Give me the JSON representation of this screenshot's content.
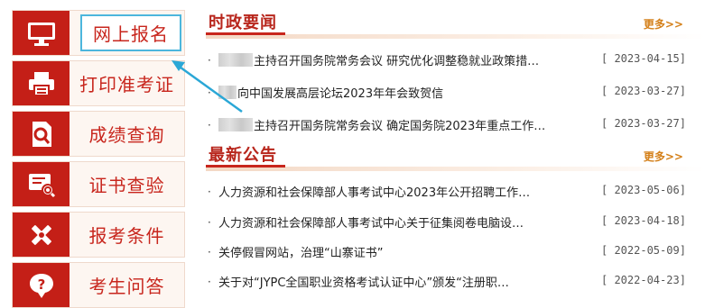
{
  "menu": {
    "items": [
      {
        "label": "网上报名",
        "icon": "monitor-icon",
        "active": true
      },
      {
        "label": "打印准考证",
        "icon": "printer-icon",
        "active": false
      },
      {
        "label": "成绩查询",
        "icon": "search-document-icon",
        "active": false
      },
      {
        "label": "证书查验",
        "icon": "certificate-search-icon",
        "active": false
      },
      {
        "label": "报考条件",
        "icon": "tools-icon",
        "active": false
      },
      {
        "label": "考生问答",
        "icon": "question-icon",
        "active": false
      }
    ]
  },
  "policy": {
    "title": "时政要闻",
    "more": "更多>>",
    "items": [
      {
        "prefix_blur": "wide",
        "title": "主持召开国务院常务会议 研究优化调整稳就业政策措…",
        "date": "[ 2023-04-15]"
      },
      {
        "prefix_blur": "narrow",
        "title": "向中国发展高层论坛2023年年会致贺信",
        "date": "[ 2023-03-27]"
      },
      {
        "prefix_blur": "wide",
        "title": "主持召开国务院常务会议 确定国务院2023年重点工作…",
        "date": "[ 2023-03-27]"
      }
    ]
  },
  "notice": {
    "title": "最新公告",
    "more": "更多>>",
    "items": [
      {
        "title": "人力资源和社会保障部人事考试中心2023年公开招聘工作…",
        "date": "[ 2023-05-06]"
      },
      {
        "title": "人力资源和社会保障部人事考试中心关于征集阅卷电脑设…",
        "date": "[ 2023-04-18]"
      },
      {
        "title": "关停假冒网站，治理“山寨证书”",
        "date": "[ 2022-05-09]"
      },
      {
        "title": "关于对“JYPC全国职业资格考试认证中心”颁发“注册职…",
        "date": "[ 2022-04-23]"
      }
    ]
  },
  "colors": {
    "accent": "#c8261d",
    "icon_bg": "#c41f17",
    "more": "#d4801a",
    "highlight": "#4cb6dd"
  }
}
